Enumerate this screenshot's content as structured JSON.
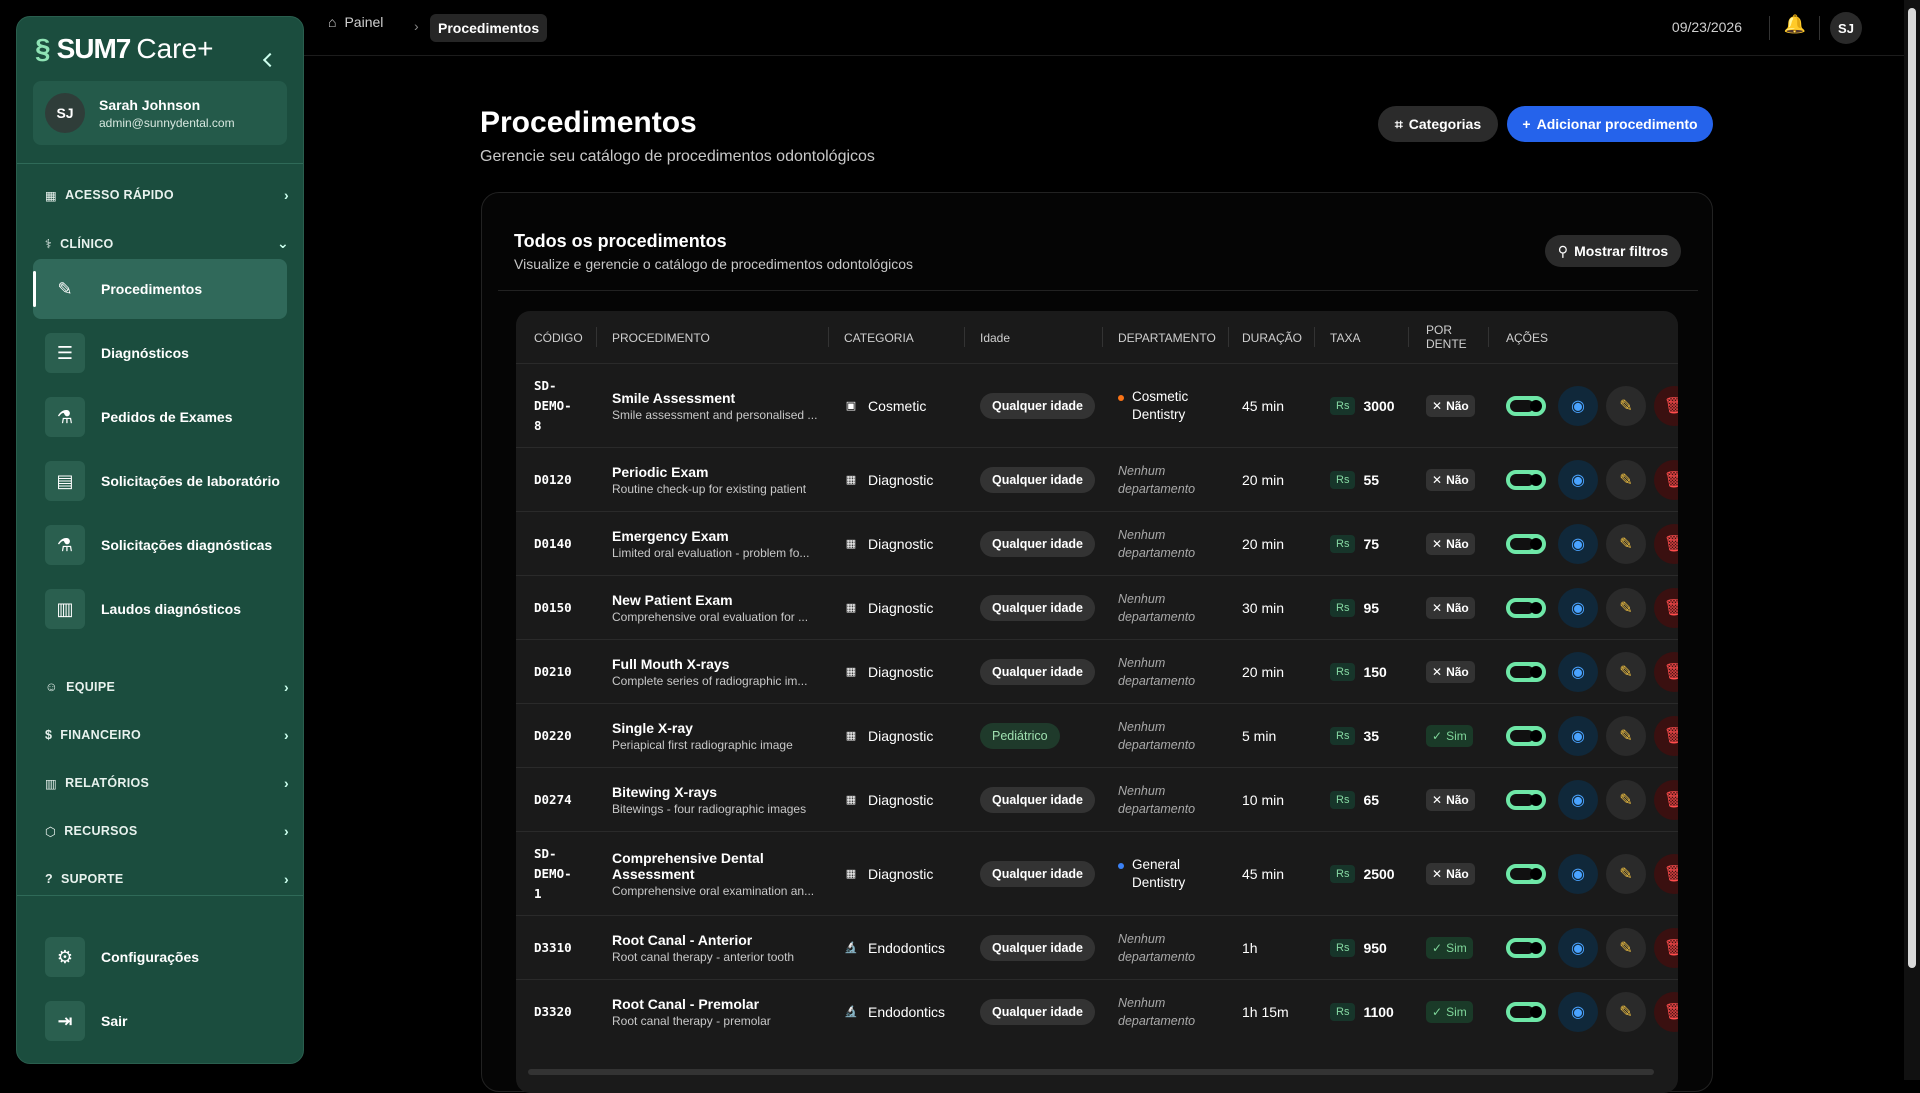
{
  "brand": {
    "name": "SUM7",
    "suffix": "Care+"
  },
  "user": {
    "initials": "SJ",
    "name": "Sarah Johnson",
    "email": "admin@sunnydental.com"
  },
  "sidebar": {
    "sections": [
      {
        "label": "ACESSO RÁPIDO",
        "icon": "grid-icon"
      },
      {
        "label": "CLÍNICO",
        "icon": "stethoscope-icon"
      },
      {
        "label": "EQUIPE",
        "icon": "users-icon"
      },
      {
        "label": "FINANCEIRO",
        "icon": "dollar-icon"
      },
      {
        "label": "RELATÓRIOS",
        "icon": "bar-chart-icon"
      },
      {
        "label": "RECURSOS",
        "icon": "package-icon"
      },
      {
        "label": "SUPORTE",
        "icon": "help-icon"
      }
    ],
    "items": [
      {
        "label": "Procedimentos",
        "icon": "bandage-icon"
      },
      {
        "label": "Diagnósticos",
        "icon": "list-check-icon"
      },
      {
        "label": "Pedidos de Exames",
        "icon": "flask-icon"
      },
      {
        "label": "Solicitações de laboratório",
        "icon": "document-icon"
      },
      {
        "label": "Solicitações diagnósticas",
        "icon": "flask-icon"
      },
      {
        "label": "Laudos diagnósticos",
        "icon": "bar-chart-icon"
      }
    ],
    "footer": [
      {
        "label": "Configurações",
        "icon": "gear-icon"
      },
      {
        "label": "Sair",
        "icon": "logout-icon"
      }
    ]
  },
  "topbar": {
    "breadcrumb": [
      "Painel",
      "Procedimentos"
    ],
    "date": "09/23/2026",
    "avatar": "SJ"
  },
  "page": {
    "title": "Procedimentos",
    "subtitle": "Gerencie seu catálogo de procedimentos odontológicos",
    "categories_btn": "Categorias",
    "add_btn": "Adicionar procedimento"
  },
  "card": {
    "title": "Todos os procedimentos",
    "subtitle": "Visualize e gerencie o catálogo de procedimentos odontológicos",
    "filter_btn": "Mostrar filtros"
  },
  "table": {
    "columns": [
      "CÓDIGO",
      "PROCEDIMENTO",
      "CATEGORIA",
      "Idade",
      "DEPARTAMENTO",
      "DURAÇÃO",
      "TAXA",
      "POR DENTE",
      "AÇÕES"
    ],
    "currency": "Rs",
    "rows": [
      {
        "code": "SD-DEMO-8",
        "name": "Smile Assessment",
        "desc": "Smile assessment and personalised ...",
        "category": "Cosmetic",
        "cat_icon": "clipboard-icon",
        "age": "Qualquer idade",
        "dept": "Cosmetic Dentistry",
        "dept_color": "#f97316",
        "duration": "45 min",
        "fee": "3000",
        "per_tooth": "Não"
      },
      {
        "code": "D0120",
        "name": "Periodic Exam",
        "desc": "Routine check-up for existing patient",
        "category": "Diagnostic",
        "cat_icon": "chart-icon",
        "age": "Qualquer idade",
        "dept": "Nenhum departamento",
        "duration": "20 min",
        "fee": "55",
        "per_tooth": "Não"
      },
      {
        "code": "D0140",
        "name": "Emergency Exam",
        "desc": "Limited oral evaluation - problem fo...",
        "category": "Diagnostic",
        "cat_icon": "chart-icon",
        "age": "Qualquer idade",
        "dept": "Nenhum departamento",
        "duration": "20 min",
        "fee": "75",
        "per_tooth": "Não"
      },
      {
        "code": "D0150",
        "name": "New Patient Exam",
        "desc": "Comprehensive oral evaluation for ...",
        "category": "Diagnostic",
        "cat_icon": "chart-icon",
        "age": "Qualquer idade",
        "dept": "Nenhum departamento",
        "duration": "30 min",
        "fee": "95",
        "per_tooth": "Não"
      },
      {
        "code": "D0210",
        "name": "Full Mouth X-rays",
        "desc": "Complete series of radiographic im...",
        "category": "Diagnostic",
        "cat_icon": "chart-icon",
        "age": "Qualquer idade",
        "dept": "Nenhum departamento",
        "duration": "20 min",
        "fee": "150",
        "per_tooth": "Não"
      },
      {
        "code": "D0220",
        "name": "Single X-ray",
        "desc": "Periapical first radiographic image",
        "category": "Diagnostic",
        "cat_icon": "chart-icon",
        "age": "Pediátrico",
        "dept": "Nenhum departamento",
        "duration": "5 min",
        "fee": "35",
        "per_tooth": "Sim"
      },
      {
        "code": "D0274",
        "name": "Bitewing X-rays",
        "desc": "Bitewings - four radiographic images",
        "category": "Diagnostic",
        "cat_icon": "chart-icon",
        "age": "Qualquer idade",
        "dept": "Nenhum departamento",
        "duration": "10 min",
        "fee": "65",
        "per_tooth": "Não"
      },
      {
        "code": "SD-DEMO-1",
        "name": "Comprehensive Dental Assessment",
        "desc": "Comprehensive oral examination an...",
        "category": "Diagnostic",
        "cat_icon": "chart-icon",
        "age": "Qualquer idade",
        "dept": "General Dentistry",
        "dept_color": "#3b82f6",
        "duration": "45 min",
        "fee": "2500",
        "per_tooth": "Não"
      },
      {
        "code": "D3310",
        "name": "Root Canal - Anterior",
        "desc": "Root canal therapy - anterior tooth",
        "category": "Endodontics",
        "cat_icon": "microscope-icon",
        "age": "Qualquer idade",
        "dept": "Nenhum departamento",
        "duration": "1h",
        "fee": "950",
        "per_tooth": "Sim"
      },
      {
        "code": "D3320",
        "name": "Root Canal - Premolar",
        "desc": "Root canal therapy - premolar",
        "category": "Endodontics",
        "cat_icon": "microscope-icon",
        "age": "Qualquer idade",
        "dept": "Nenhum departamento",
        "duration": "1h 15m",
        "fee": "1100",
        "per_tooth": "Sim"
      }
    ]
  }
}
